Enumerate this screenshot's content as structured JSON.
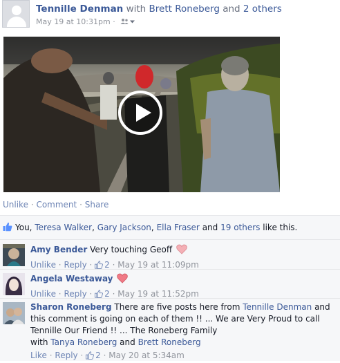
{
  "post": {
    "actor": "Tennille Denman",
    "with_word": "with",
    "tagged": "Brett Roneberg",
    "and_word": "and",
    "others": "2 others",
    "timestamp": "May 19 at 10:31pm",
    "dot": "·",
    "audience_icon": "friends-icon"
  },
  "video": {
    "play_icon": "play-icon"
  },
  "actions": {
    "unlike": "Unlike",
    "comment": "Comment",
    "share": "Share",
    "dot": "·"
  },
  "likes": {
    "you": "You,",
    "names": [
      "Teresa Walker",
      "Gary Jackson",
      "Ella Fraser"
    ],
    "and_word": "and",
    "others": "19 others",
    "suffix": "like this.",
    "comma": ","
  },
  "comments": [
    {
      "author": "Amy Bender",
      "text": "Very touching Geoff",
      "emoji": "heart-icon",
      "action": "Unlike",
      "reply": "Reply",
      "like_count": "2",
      "time": "May 19 at 11:09pm"
    },
    {
      "author": "Angela Westaway",
      "text": "",
      "emoji": "heart-icon",
      "action": "Unlike",
      "reply": "Reply",
      "like_count": "2",
      "time": "May 19 at 11:52pm"
    },
    {
      "author": "Sharon Roneberg",
      "text_1": "There are five posts here from",
      "mention_1": "Tennille Denman",
      "text_2": "and this comment is going on each of them !! ... We are Very Proud to call Tennille Our Friend !! ... The Roneberg Family",
      "with_word": "with",
      "mention_2": "Tanya Roneberg",
      "and_word": "and",
      "mention_3": "Brett Roneberg",
      "action": "Like",
      "reply": "Reply",
      "like_count": "2",
      "time": "May 20 at 5:34am"
    }
  ],
  "colors": {
    "link": "#3b5998",
    "action": "#6d84b4",
    "meta": "#90949c",
    "heart": "#f4a0a8"
  }
}
